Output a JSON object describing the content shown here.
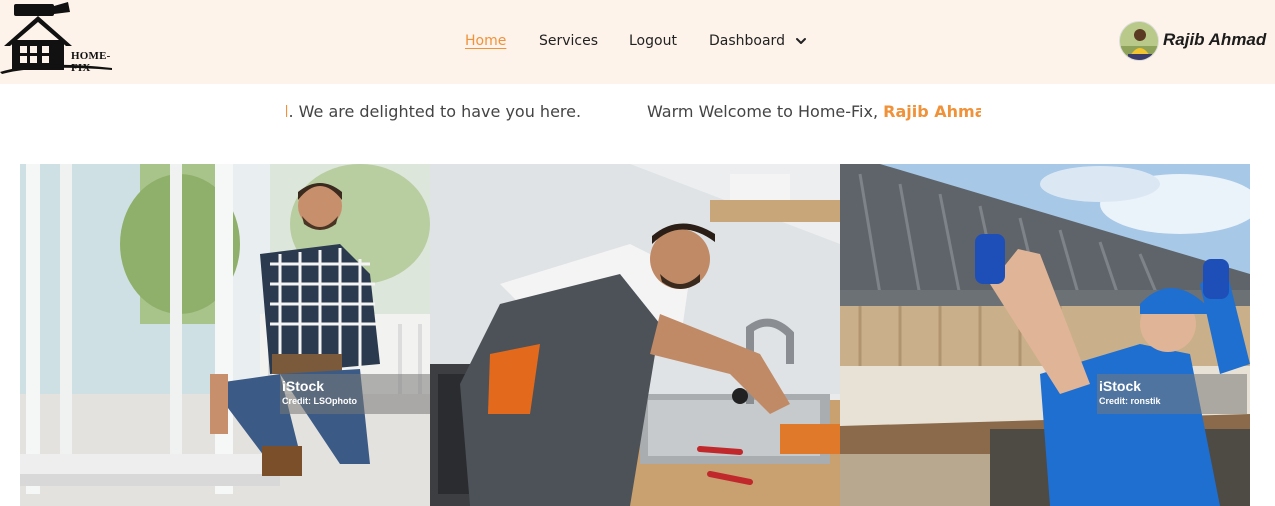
{
  "brand": {
    "logo_text": "HOME-FIX"
  },
  "nav": {
    "items": [
      {
        "label": "Home",
        "active": true
      },
      {
        "label": "Services",
        "active": false
      },
      {
        "label": "Logout",
        "active": false
      },
      {
        "label": "Dashboard",
        "active": false,
        "icon": "chevron-down-icon"
      }
    ]
  },
  "user": {
    "name": "Rajib Ahmad",
    "avatar_icon": "avatar"
  },
  "welcome": {
    "tail_highlight": "d",
    "tail_text": ". We are delighted to have you here.",
    "prefix": "Warm Welcome to Home-Fix, ",
    "name_partial": "Rajib Ahmad"
  },
  "gallery": [
    {
      "watermark": "iStock",
      "credit": "Credit: LSOphoto",
      "subject": "man installing sliding glass door"
    },
    {
      "watermark": "",
      "credit": "",
      "subject": "plumber fixing kitchen sink"
    },
    {
      "watermark": "iStock",
      "credit": "Credit: ronstik",
      "subject": "worker cleaning roof gutter"
    }
  ],
  "colors": {
    "accent": "#f0923a",
    "navbar_bg": "#fdf3ea",
    "text": "#222222"
  }
}
